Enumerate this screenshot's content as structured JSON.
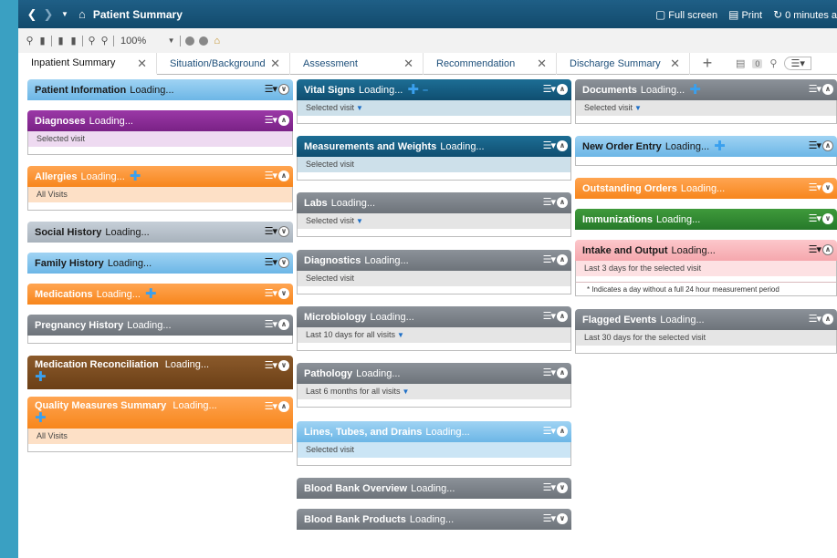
{
  "window": {
    "title": "Patient Summary",
    "full_screen": "Full screen",
    "print": "Print",
    "refresh": "0 minutes a"
  },
  "toolbar": {
    "zoom": "100%"
  },
  "tabs": [
    {
      "label": "Inpatient Summary"
    },
    {
      "label": "Situation/Background"
    },
    {
      "label": "Assessment"
    },
    {
      "label": "Recommendation"
    },
    {
      "label": "Discharge Summary"
    }
  ],
  "tab_tools": {
    "badge": "0"
  },
  "loading_text": "Loading...",
  "components": {
    "patient_information": {
      "title": "Patient Information"
    },
    "diagnoses": {
      "title": "Diagnoses",
      "sub": "Selected visit"
    },
    "allergies": {
      "title": "Allergies",
      "sub": "All Visits"
    },
    "social_history": {
      "title": "Social History"
    },
    "family_history": {
      "title": "Family History"
    },
    "medications": {
      "title": "Medications"
    },
    "pregnancy_history": {
      "title": "Pregnancy History"
    },
    "medication_reconciliation": {
      "title": "Medication Reconciliation"
    },
    "quality_measures": {
      "title": "Quality Measures Summary",
      "sub": "All Visits"
    },
    "vital_signs": {
      "title": "Vital Signs",
      "sub": "Selected visit"
    },
    "measurements": {
      "title": "Measurements and Weights",
      "sub": "Selected visit"
    },
    "labs": {
      "title": "Labs",
      "sub": "Selected visit"
    },
    "diagnostics": {
      "title": "Diagnostics",
      "sub": "Selected visit"
    },
    "microbiology": {
      "title": "Microbiology",
      "sub": "Last 10 days for all visits"
    },
    "pathology": {
      "title": "Pathology",
      "sub": "Last 6 months for all visits"
    },
    "lines_tubes_drains": {
      "title": "Lines, Tubes, and Drains",
      "sub": "Selected visit"
    },
    "blood_bank_overview": {
      "title": "Blood Bank Overview"
    },
    "blood_bank_products": {
      "title": "Blood Bank Products"
    },
    "documents": {
      "title": "Documents",
      "sub": "Selected visit"
    },
    "new_order_entry": {
      "title": "New Order Entry"
    },
    "outstanding_orders": {
      "title": "Outstanding Orders"
    },
    "immunizations": {
      "title": "Immunizations"
    },
    "intake_output": {
      "title": "Intake and Output",
      "sub": "Last 3 days for the selected visit",
      "note": "* Indicates a day without a full 24 hour measurement period"
    },
    "flagged_events": {
      "title": "Flagged Events",
      "sub": "Last 30 days for the selected visit"
    }
  },
  "colors": {
    "light_blue": "#6cb6e6",
    "purple": "#7a2286",
    "orange": "#f7861c",
    "dark_blue": "#0f4e70",
    "brown": "#6b3f16",
    "green": "#26792a",
    "pink": "#f5a7ad"
  }
}
